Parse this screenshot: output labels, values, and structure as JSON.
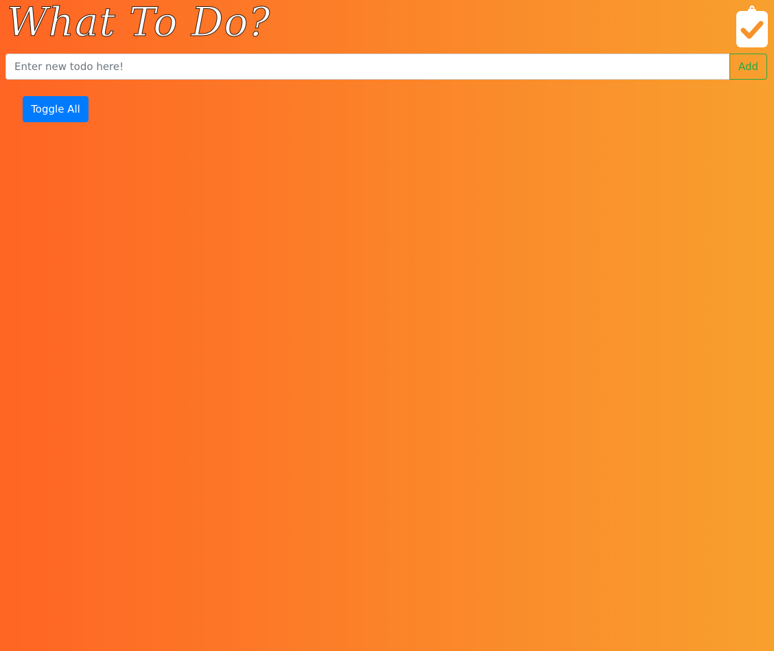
{
  "header": {
    "title": "What To Do?",
    "logo_icon": "clipboard-check-icon"
  },
  "todo_form": {
    "input_value": "",
    "input_placeholder": "Enter new todo here!",
    "add_label": "Add"
  },
  "controls": {
    "toggle_all_label": "Toggle All"
  },
  "todos": [],
  "colors": {
    "background_start": "#ff6524",
    "background_end": "#f8a02e",
    "add_button": "#28a745",
    "toggle_button": "#007bff",
    "title": "#ffffff"
  }
}
